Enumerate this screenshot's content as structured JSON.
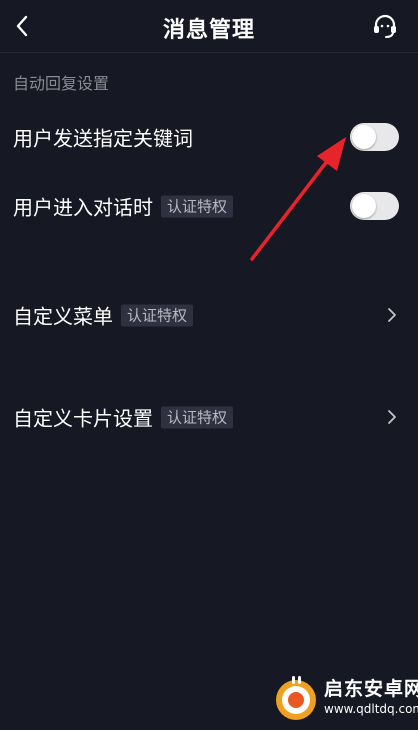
{
  "header": {
    "title": "消息管理",
    "back_icon": "chevron-left-icon",
    "support_icon": "headset-icon"
  },
  "section": {
    "label": "自动回复设置"
  },
  "rows": [
    {
      "label": "用户发送指定关键词",
      "control": "toggle",
      "on": false
    },
    {
      "label": "用户进入对话时",
      "badge": "认证特权",
      "control": "toggle",
      "on": false
    },
    {
      "label": "自定义菜单",
      "badge": "认证特权",
      "control": "chevron-right-icon"
    },
    {
      "label": "自定义卡片设置",
      "badge": "认证特权",
      "control": "chevron-right-icon"
    }
  ],
  "annotation": {
    "color": "#e8242a",
    "icon": "red-arrow-pointer"
  },
  "watermark": {
    "title": "启东安卓网",
    "url": "www.qdltdq.com"
  },
  "colors": {
    "background": "#161823",
    "text": "#ffffff",
    "muted": "#8a8b93",
    "badge_bg": "#2f3140",
    "toggle_off": "#e8e8ea"
  }
}
